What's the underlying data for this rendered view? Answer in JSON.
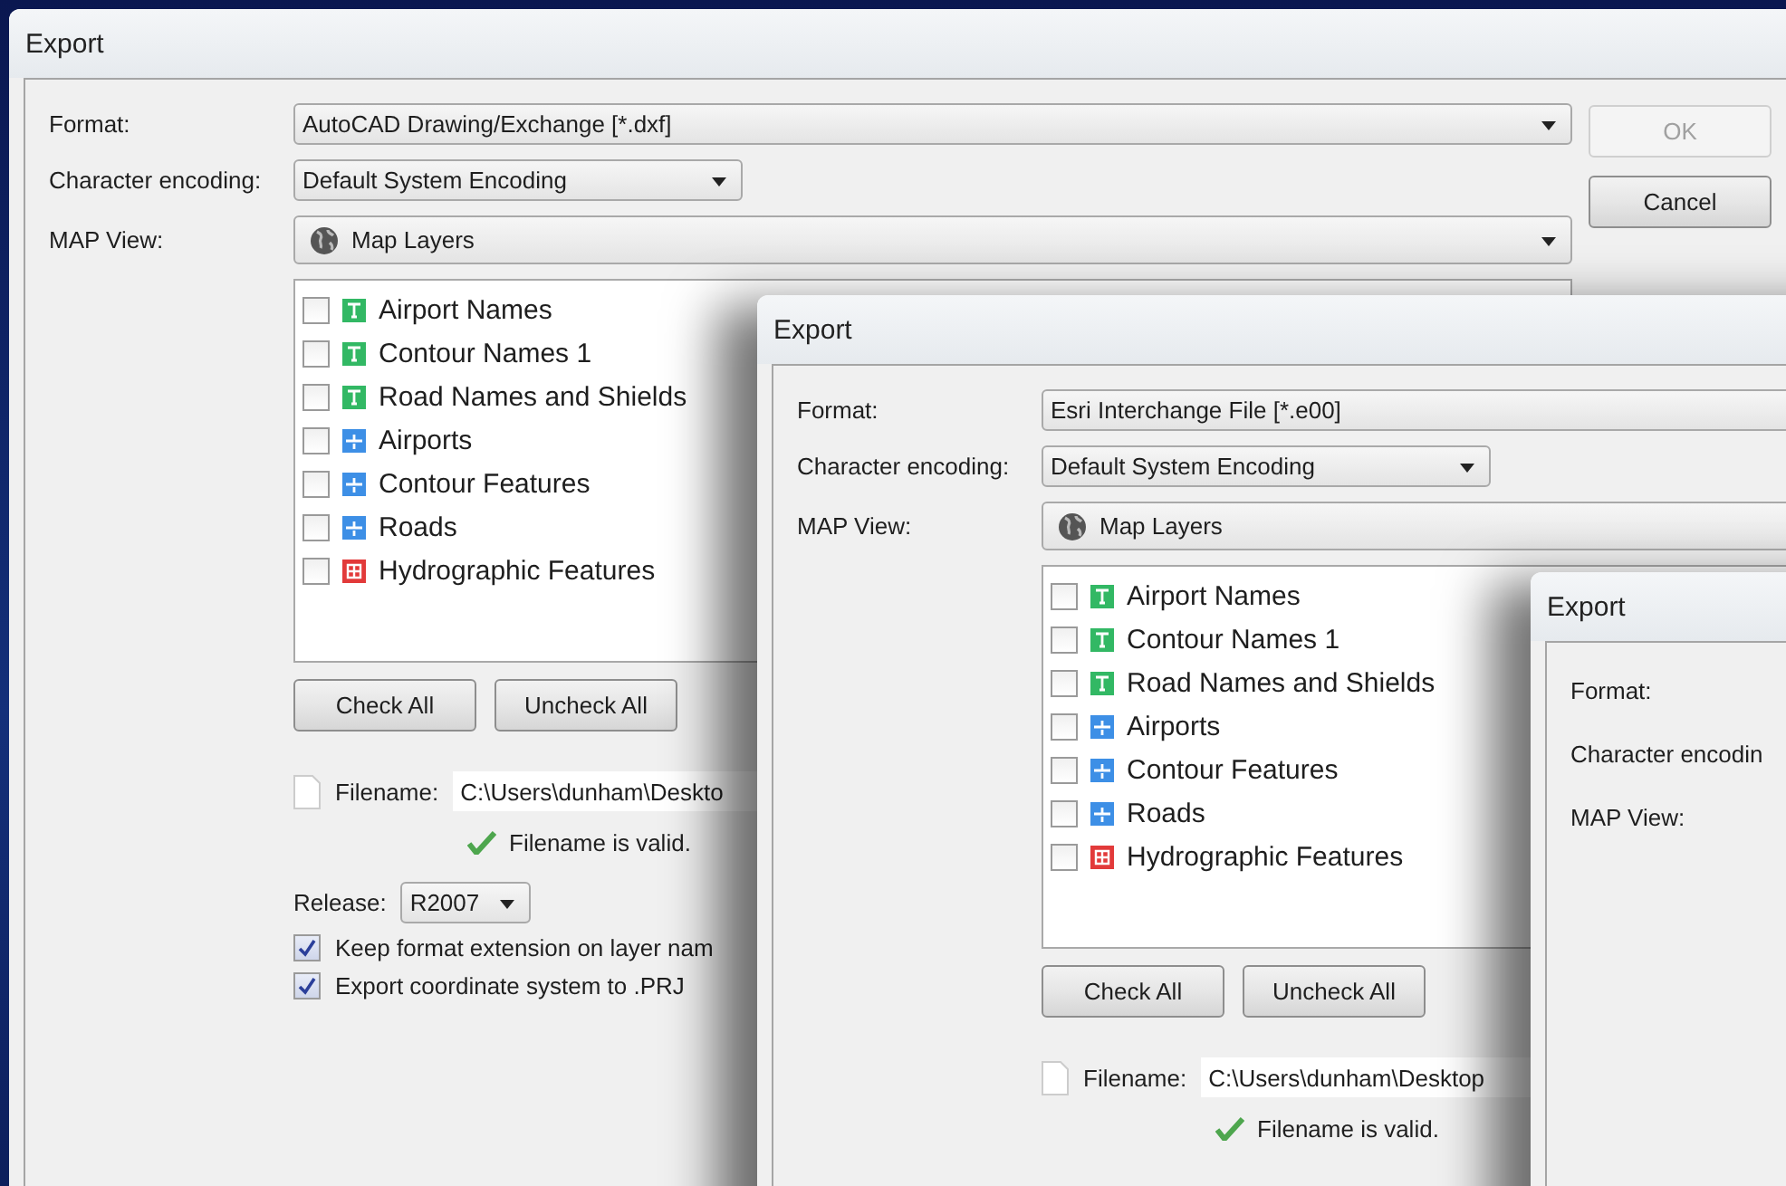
{
  "windows": [
    {
      "title": "Export",
      "format_label": "Format:",
      "format": "AutoCAD Drawing/Exchange [*.dxf]",
      "encoding_label": "Character encoding:",
      "encoding": "Default System Encoding",
      "map_view_label": "MAP View:",
      "map_view": "Map Layers",
      "buttons": [
        {
          "label": "OK",
          "disabled": true
        },
        {
          "label": "Cancel",
          "disabled": false
        }
      ],
      "layers": [
        {
          "name": "Airport Names",
          "kind": "text",
          "checked": false
        },
        {
          "name": "Contour Names 1",
          "kind": "text",
          "checked": false
        },
        {
          "name": "Road Names and Shields",
          "kind": "text",
          "checked": false
        },
        {
          "name": "Airports",
          "kind": "vector",
          "checked": false
        },
        {
          "name": "Contour Features",
          "kind": "vector",
          "checked": false
        },
        {
          "name": "Roads",
          "kind": "vector",
          "checked": false
        },
        {
          "name": "Hydrographic Features",
          "kind": "grid",
          "checked": false
        }
      ],
      "check_all": "Check All",
      "uncheck_all": "Uncheck All",
      "filename_label": "Filename:",
      "filename": "C:\\Users\\dunham\\Deskto",
      "validation": "Filename is valid.",
      "release_label": "Release:",
      "release": "R2007",
      "options": [
        {
          "label": "Keep format extension on layer nam",
          "checked": true
        },
        {
          "label": "Export coordinate system to .PRJ",
          "checked": true
        }
      ]
    },
    {
      "title": "Export",
      "format_label": "Format:",
      "format": "Esri Interchange File [*.e00]",
      "encoding_label": "Character encoding:",
      "encoding": "Default System Encoding",
      "map_view_label": "MAP View:",
      "map_view": "Map Layers",
      "layers": [
        {
          "name": "Airport Names",
          "kind": "text",
          "checked": false
        },
        {
          "name": "Contour Names 1",
          "kind": "text",
          "checked": false
        },
        {
          "name": "Road Names and Shields",
          "kind": "text",
          "checked": false
        },
        {
          "name": "Airports",
          "kind": "vector",
          "checked": false
        },
        {
          "name": "Contour Features",
          "kind": "vector",
          "checked": false
        },
        {
          "name": "Roads",
          "kind": "vector",
          "checked": false
        },
        {
          "name": "Hydrographic Features",
          "kind": "grid",
          "checked": false
        }
      ],
      "check_all": "Check All",
      "uncheck_all": "Uncheck All",
      "filename_label": "Filename:",
      "filename": "C:\\Users\\dunham\\Desktop",
      "validation": "Filename is valid."
    },
    {
      "title": "Export",
      "format_label": "Format:",
      "encoding_label": "Character encodin",
      "map_view_label": "MAP View:"
    }
  ]
}
